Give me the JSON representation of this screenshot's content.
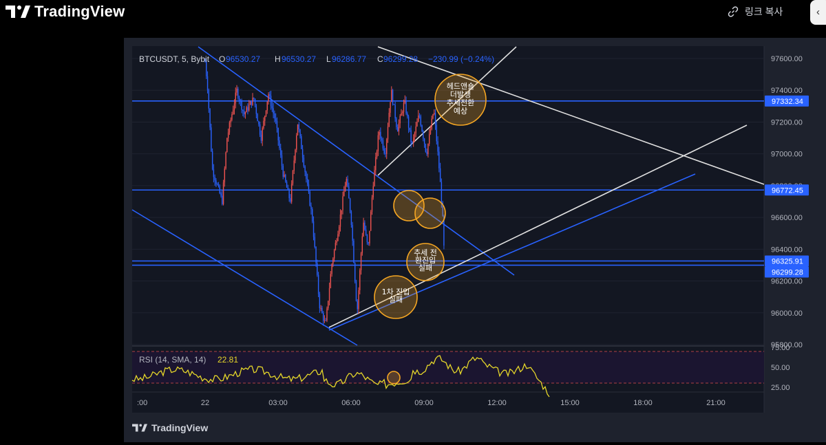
{
  "header": {
    "brand": "TradingView",
    "copy_link_label": "링크 복사",
    "corner_icon": "chevron-icon"
  },
  "footer": {
    "brand": "TradingView"
  },
  "legend": {
    "symbol": "BTCUSDT, 5, Bybit",
    "open_label": "O",
    "open": "96530.27",
    "high_label": "H",
    "high": "96530.27",
    "low_label": "L",
    "low": "96286.77",
    "close_label": "C",
    "close": "96299.28",
    "change": "−230.99 (−0.24%)"
  },
  "rsi_legend": {
    "label": "RSI (14, SMA, 14)",
    "value": "22.81"
  },
  "price_axis": {
    "ticks": [
      "97600.00",
      "97400.00",
      "97200.00",
      "97000.00",
      "96800.00",
      "96600.00",
      "96400.00",
      "96200.00",
      "96000.00",
      "95800.00"
    ],
    "highlighted": [
      {
        "value": "97332.34",
        "color": "#2962ff"
      },
      {
        "value": "96772.45",
        "color": "#2962ff"
      },
      {
        "value": "96325.91",
        "color": "#2962ff"
      },
      {
        "value": "96299.28",
        "color": "#2962ff"
      }
    ]
  },
  "rsi_axis": {
    "ticks": [
      "75.00",
      "50.00",
      "25.00"
    ]
  },
  "time_axis": {
    "ticks": [
      ":00",
      "22",
      "03:00",
      "06:00",
      "09:00",
      "12:00",
      "15:00",
      "18:00",
      "21:00"
    ]
  },
  "annotations": [
    {
      "lines": [
        "헤드앤숄",
        "더발생",
        "추세전환",
        "예상"
      ]
    },
    {
      "lines": [
        "추세 전",
        "환진입",
        "실패"
      ]
    },
    {
      "lines": [
        "1차 진입",
        "실패"
      ]
    }
  ],
  "colors": {
    "up": "#ef5350",
    "down": "#2962ff",
    "line": "#2962ff",
    "white_line": "#e0e0e0",
    "circle": "#f5a623",
    "rsi": "#e6d72a"
  },
  "chart_data": {
    "type": "candlestick",
    "symbol": "BTCUSDT",
    "interval": "5",
    "exchange": "Bybit",
    "ylim": [
      95800,
      97700
    ],
    "x_ticks": [
      ":00",
      "22",
      "03:00",
      "06:00",
      "09:00",
      "12:00",
      "15:00",
      "18:00",
      "21:00"
    ],
    "price_path": [
      [
        "22:00",
        97580
      ],
      [
        "22:10",
        97420
      ],
      [
        "22:30",
        96900
      ],
      [
        "23:10",
        96700
      ],
      [
        "23:30",
        97100
      ],
      [
        "00:10",
        97400
      ],
      [
        "00:40",
        97250
      ],
      [
        "01:20",
        97350
      ],
      [
        "01:50",
        97100
      ],
      [
        "02:20",
        97380
      ],
      [
        "02:50",
        97200
      ],
      [
        "03:20",
        96880
      ],
      [
        "03:50",
        96700
      ],
      [
        "04:20",
        97200
      ],
      [
        "04:50",
        96900
      ],
      [
        "05:20",
        96600
      ],
      [
        "05:50",
        96050
      ],
      [
        "06:15",
        95920
      ],
      [
        "06:40",
        96300
      ],
      [
        "07:10",
        96550
      ],
      [
        "07:40",
        96850
      ],
      [
        "08:00",
        96600
      ],
      [
        "08:25",
        96000
      ],
      [
        "08:50",
        96580
      ],
      [
        "09:10",
        96400
      ],
      [
        "09:30",
        96800
      ],
      [
        "09:55",
        97150
      ],
      [
        "10:20",
        97000
      ],
      [
        "10:45",
        97400
      ],
      [
        "11:10",
        97150
      ],
      [
        "11:40",
        97330
      ],
      [
        "12:10",
        97050
      ],
      [
        "12:40",
        97250
      ],
      [
        "13:10",
        97000
      ],
      [
        "13:40",
        97280
      ],
      [
        "14:00",
        96950
      ],
      [
        "14:15",
        96650
      ],
      [
        "14:25",
        96299.28
      ]
    ],
    "horizontal_levels": [
      97332.34,
      96772.45,
      96325.91,
      96299.28
    ],
    "rsi": {
      "label": "RSI (14, SMA, 14)",
      "period": 14,
      "last": 22.81,
      "ylim": [
        20,
        80
      ],
      "bands": [
        70,
        30
      ],
      "ticks": [
        75,
        50,
        25
      ]
    }
  }
}
